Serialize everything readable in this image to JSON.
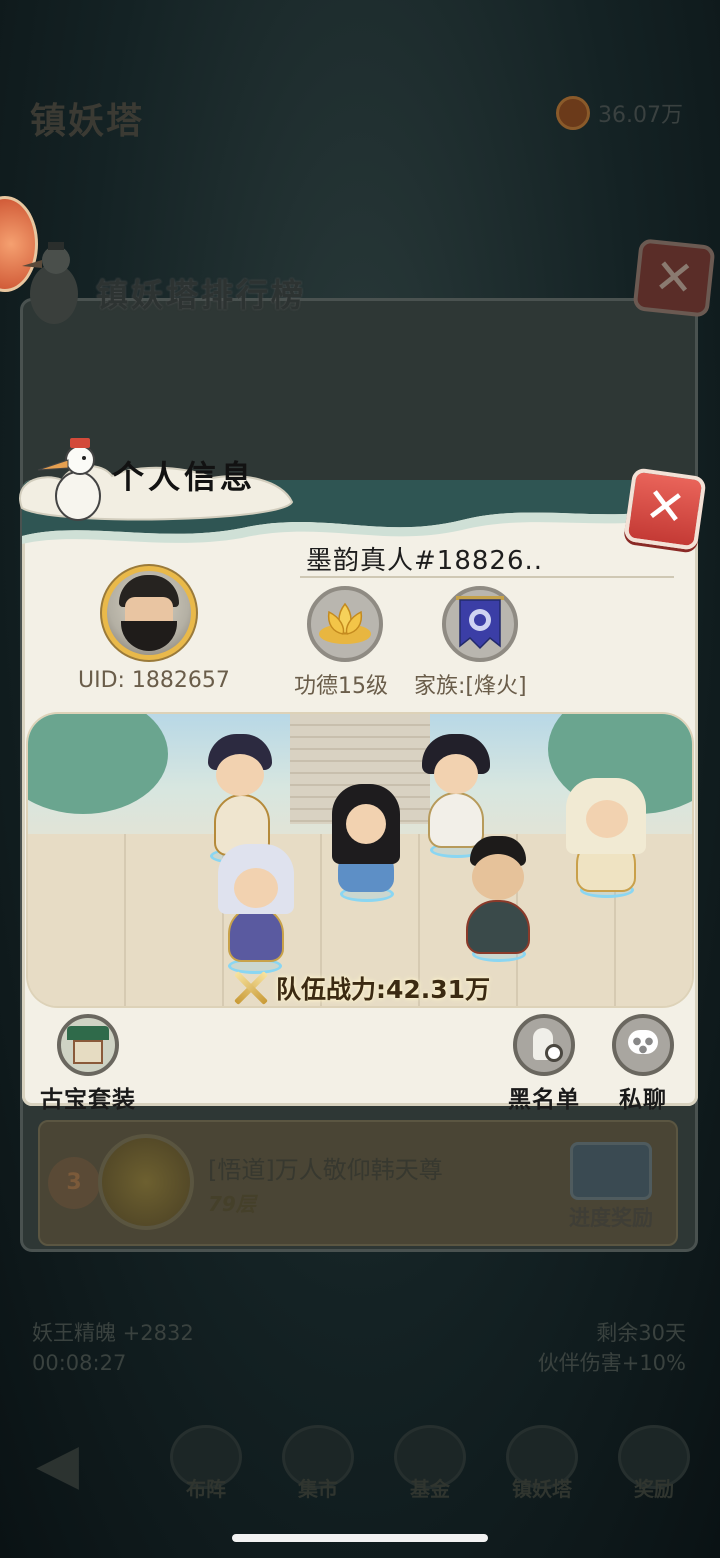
{
  "background": {
    "screen_title": "镇妖塔",
    "currency_value": "36.07万",
    "bottom_left": {
      "line1": "妖王精魄 +2832",
      "line2": "00:08:27"
    },
    "bottom_right": {
      "line1": "剩余30天",
      "line2": "伙伴伤害+10%"
    },
    "nav": [
      "布阵",
      "集市",
      "基金",
      "镇妖塔",
      "奖励"
    ]
  },
  "ranking": {
    "title": "镇妖塔排行榜",
    "close_symbol": "✕",
    "row": {
      "rank": "3",
      "name": "[悟道]万人敬仰韩天尊",
      "floor": "79层",
      "reward_label": "进度奖励"
    }
  },
  "info": {
    "title": "个人信息",
    "close_symbol": "✕",
    "player_name": "墨韵真人#18826..",
    "uid": "UID: 1882657",
    "merit": "功德15级",
    "family": "家族:[烽火]",
    "team_power": "队伍战力:42.31万",
    "actions": {
      "treasure": "古宝套装",
      "blacklist": "黑名单",
      "chat": "私聊"
    }
  },
  "icons": {
    "close": "close-icon",
    "lotus": "lotus-icon",
    "banner": "family-banner-icon",
    "sword": "crossed-swords-icon",
    "treasure": "temple-icon",
    "blacklist": "blacklist-icon",
    "chat": "chat-bubble-icon"
  },
  "colors": {
    "accent_gold": "#e9b94a",
    "close_red": "#c43a35",
    "panel_bg": "#f3f0e6"
  }
}
